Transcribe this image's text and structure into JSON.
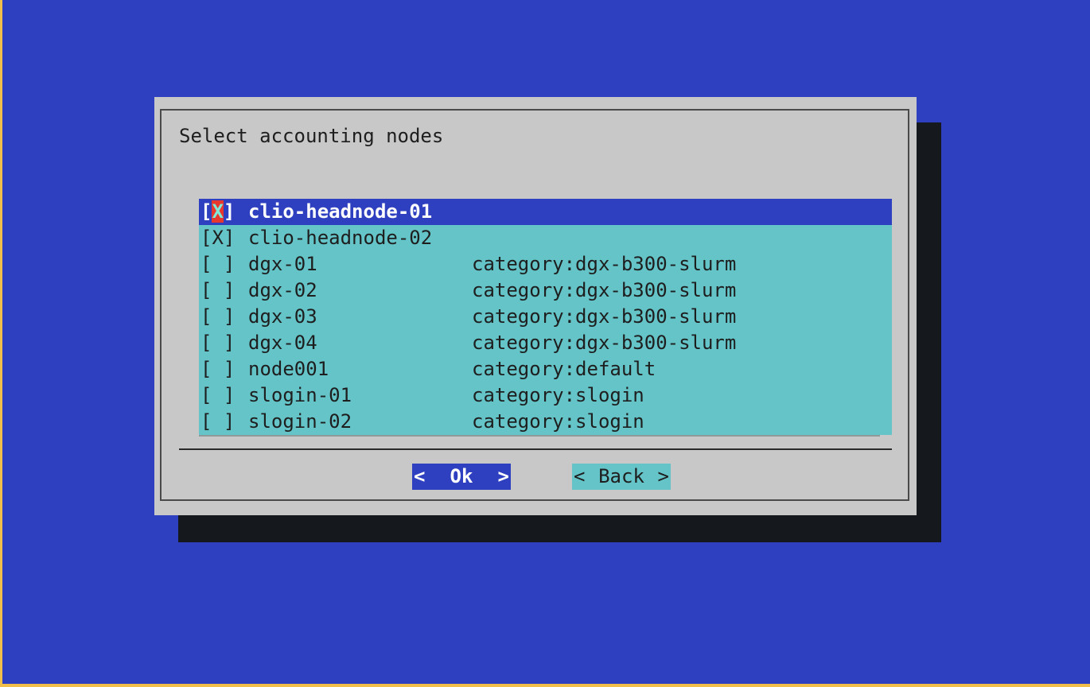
{
  "dialog": {
    "title": "Select accounting nodes",
    "nodes": [
      {
        "check_open": "[",
        "mark": "X",
        "check_close": "]",
        "name": "clio-headnode-01",
        "category": ""
      },
      {
        "check_open": "[",
        "mark": "X",
        "check_close": "]",
        "name": "clio-headnode-02",
        "category": ""
      },
      {
        "check_open": "[",
        "mark": " ",
        "check_close": "]",
        "name": "dgx-01",
        "category": "category:dgx-b300-slurm"
      },
      {
        "check_open": "[",
        "mark": " ",
        "check_close": "]",
        "name": "dgx-02",
        "category": "category:dgx-b300-slurm"
      },
      {
        "check_open": "[",
        "mark": " ",
        "check_close": "]",
        "name": "dgx-03",
        "category": "category:dgx-b300-slurm"
      },
      {
        "check_open": "[",
        "mark": " ",
        "check_close": "]",
        "name": "dgx-04",
        "category": "category:dgx-b300-slurm"
      },
      {
        "check_open": "[",
        "mark": " ",
        "check_close": "]",
        "name": "node001",
        "category": "category:default"
      },
      {
        "check_open": "[",
        "mark": " ",
        "check_close": "]",
        "name": "slogin-01",
        "category": "category:slogin"
      },
      {
        "check_open": "[",
        "mark": " ",
        "check_close": "]",
        "name": "slogin-02",
        "category": "category:slogin"
      }
    ],
    "buttons": {
      "ok": {
        "left": "<",
        "label": "Ok",
        "right": ">"
      },
      "back": {
        "left": "<",
        "label": "Back",
        "right": ">"
      }
    }
  },
  "colors": {
    "screen_background": "#2e40c0",
    "dialog_background": "#c8c8c8",
    "list_background": "#64c4c8",
    "selected_row": "#2e40c0",
    "cursor_mark": "#e8372c",
    "shadow": "#15181c"
  }
}
